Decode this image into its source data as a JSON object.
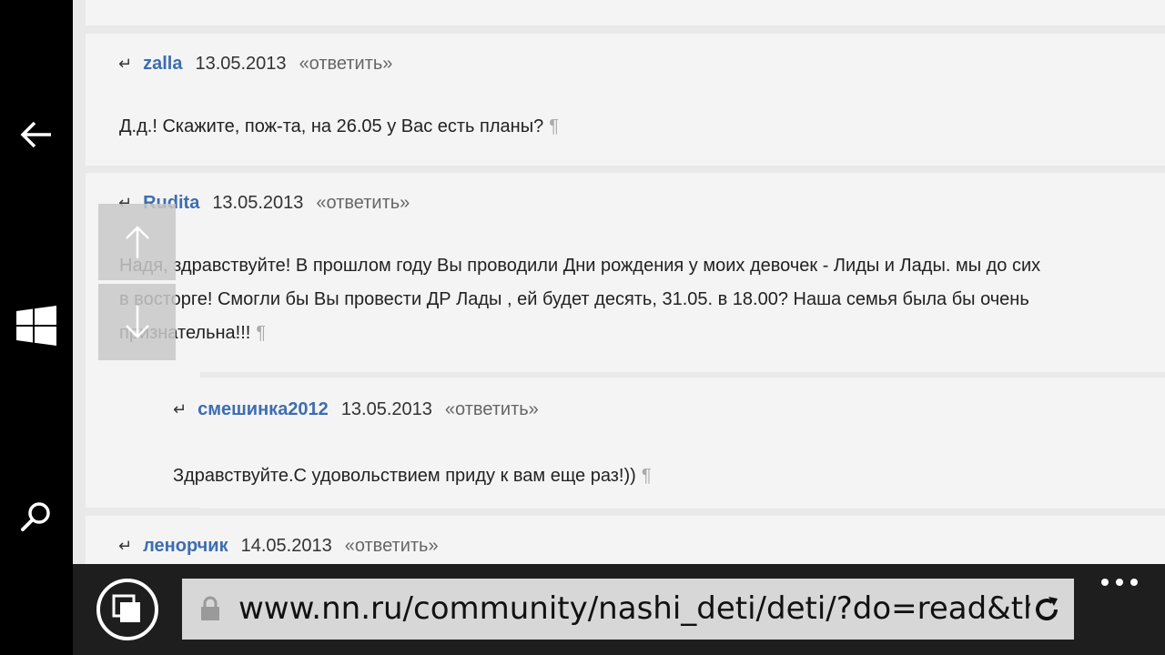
{
  "nav": {
    "back_icon": "arrow-left-icon",
    "start_icon": "windows-logo-icon",
    "search_icon": "search-icon"
  },
  "comments": [
    {
      "author": "zalla",
      "date": "13.05.2013",
      "reply": "«ответить»",
      "text": [
        "Д.д.! Скажите, пож-та, на 26.05 у Вас есть планы?"
      ]
    },
    {
      "author": "Rudita",
      "date": "13.05.2013",
      "reply": "«ответить»",
      "text": [
        "Надя, здравствуйте! В прошлом году Вы проводили Дни рождения у моих девочек - Лиды и Лады. мы до сих",
        "в восторге! Смогли бы Вы провести ДР Лады , ей будет десять, 31.05. в 18.00? Наша семья была бы очень",
        "признательна!!!"
      ],
      "reply_child": {
        "author": "смешинка2012",
        "date": "13.05.2013",
        "reply": "«ответить»",
        "text": [
          "Здравствуйте.С удовольствием приду к вам еще раз!))"
        ]
      }
    },
    {
      "author": "ленорчик",
      "date": "14.05.2013",
      "reply": "«ответить»"
    }
  ],
  "symbols": {
    "reply_arrow": "↵",
    "pilcrow": "¶"
  },
  "address_bar": {
    "url": "www.nn.ru/community/nashi_deti/deti/?do=read&threa"
  },
  "colors": {
    "author_link": "#3d6db0",
    "bar_background": "#1e1e1e",
    "address_background": "#d7d7d7"
  }
}
